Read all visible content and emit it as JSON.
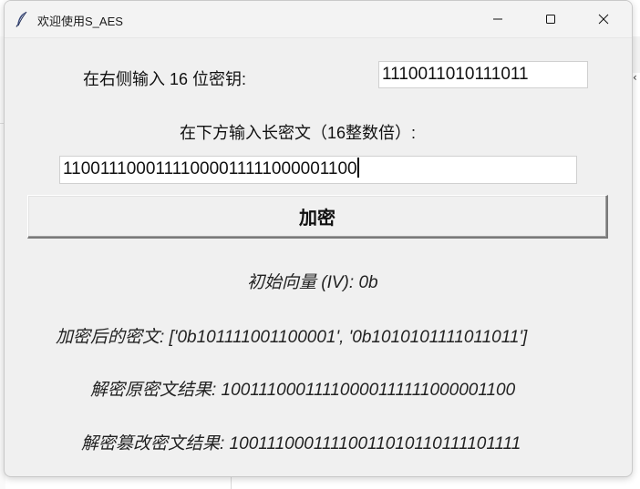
{
  "window": {
    "title": "欢迎使用S_AES"
  },
  "form": {
    "key_label": "在右侧输入 16 位密钥:",
    "key_value": "1110011010111011",
    "ciphertext_label": "在下方输入长密文（16整数倍）:",
    "ciphertext_value": "11001110001111000011111000001100",
    "encrypt_button": "加密"
  },
  "results": {
    "iv": "初始向量 (IV): 0b",
    "encrypted": "加密后的密文: ['0b101111001100001', '0b1010101111011011']",
    "decrypt_original": "解密原密文结果: 10011100011110000111111000001100",
    "decrypt_tampered": "解密篡改密文结果: 10011100011110011010110111101111"
  },
  "icons": {
    "app": "feather-icon",
    "minimize": "minimize-icon",
    "maximize": "maximize-icon",
    "close": "close-icon"
  }
}
